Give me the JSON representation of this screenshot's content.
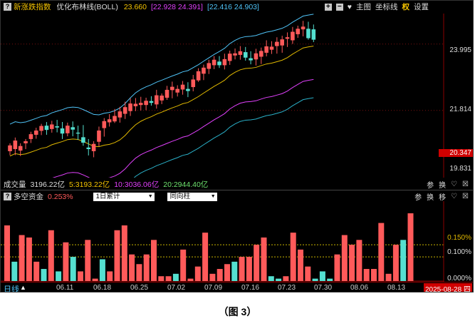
{
  "title_bar": {
    "indicator_name": "新涨跌指数",
    "study_name": "优化布林线(BOLL)",
    "mid_value": "23.660",
    "upper_values": "[22.928 24.391]",
    "lower_values": "[22.416 24.903]",
    "plus_icon": "+",
    "minus_icon": "−",
    "heart_icon": "♥",
    "main_chart_label": "主图",
    "coord_label": "坐标线",
    "weight_label": "权",
    "settings_label": "设置"
  },
  "main_axis": {
    "labels": [
      "23.995",
      "21.814",
      "20.347",
      "19.831"
    ],
    "current_price": "20.347"
  },
  "volume_bar": {
    "label": "成交量",
    "value": "3196.22亿",
    "ma5": "5:3193.22亿",
    "ma10": "10:3036.06亿",
    "ma20": "20:2944.40亿",
    "btn_params": "参",
    "btn_switch": "换",
    "heart_icon": "♡",
    "close_icon": "☒"
  },
  "fund_bar": {
    "label": "多空资金",
    "value": "0.253%",
    "select_period": "1日累计",
    "select_style": "同向柱",
    "btn_params": "参",
    "btn_switch": "换",
    "btn_move": "移",
    "heart_icon": "♡",
    "close_icon": "☒"
  },
  "sub_axis": {
    "labels": [
      "0.150%",
      "0.100%",
      "0.000%"
    ]
  },
  "bottom_axis": {
    "period": "日线",
    "dates": [
      "06.11",
      "06.18",
      "06.25",
      "07.02",
      "07.09",
      "07.16",
      "07.23",
      "07.30",
      "08.06",
      "08.13"
    ],
    "current_date": "2025-08-28",
    "weekday": "四"
  },
  "caption": "（图 3）",
  "colors": {
    "up": "#ff5a5a",
    "down": "#54e0d0",
    "boll_outer": "#4fc3f7",
    "boll_mid": "#e0b800",
    "boll_lower": "#e040fb",
    "boll_lowest": "#2ab0c8"
  },
  "chart_data": [
    {
      "type": "candlestick",
      "title": "优化布林线(BOLL)",
      "ylim": [
        19.6,
        25.0
      ],
      "indicator_values": {
        "mid": 23.66,
        "band1": [
          22.928,
          24.391
        ],
        "band2": [
          22.416,
          24.903
        ]
      },
      "candles": [
        {
          "o": 20.47,
          "h": 20.73,
          "l": 20.34,
          "c": 20.66
        },
        {
          "o": 20.54,
          "h": 20.92,
          "l": 20.34,
          "c": 20.82
        },
        {
          "o": 20.49,
          "h": 20.73,
          "l": 20.31,
          "c": 20.64
        },
        {
          "o": 20.73,
          "h": 20.87,
          "l": 20.54,
          "c": 20.8
        },
        {
          "o": 20.87,
          "h": 21.11,
          "l": 20.74,
          "c": 21.03
        },
        {
          "o": 21.01,
          "h": 21.24,
          "l": 20.88,
          "c": 21.15
        },
        {
          "o": 21.14,
          "h": 21.37,
          "l": 21.0,
          "c": 21.3
        },
        {
          "o": 21.31,
          "h": 21.43,
          "l": 21.01,
          "c": 21.17
        },
        {
          "o": 21.2,
          "h": 21.47,
          "l": 21.08,
          "c": 21.35
        },
        {
          "o": 21.29,
          "h": 21.5,
          "l": 21.09,
          "c": 21.25
        },
        {
          "o": 21.22,
          "h": 21.43,
          "l": 20.87,
          "c": 21.05
        },
        {
          "o": 21.06,
          "h": 21.41,
          "l": 20.96,
          "c": 21.31
        },
        {
          "o": 21.26,
          "h": 21.45,
          "l": 20.96,
          "c": 21.18
        },
        {
          "o": 21.08,
          "h": 21.31,
          "l": 20.84,
          "c": 21.05
        },
        {
          "o": 20.93,
          "h": 21.33,
          "l": 20.65,
          "c": 20.75
        },
        {
          "o": 20.59,
          "h": 20.87,
          "l": 20.33,
          "c": 20.54
        },
        {
          "o": 20.47,
          "h": 20.8,
          "l": 20.27,
          "c": 20.71
        },
        {
          "o": 20.78,
          "h": 21.28,
          "l": 20.63,
          "c": 21.15
        },
        {
          "o": 21.23,
          "h": 21.56,
          "l": 20.95,
          "c": 21.46
        },
        {
          "o": 21.42,
          "h": 21.69,
          "l": 21.28,
          "c": 21.52
        },
        {
          "o": 21.45,
          "h": 21.86,
          "l": 21.4,
          "c": 21.63
        },
        {
          "o": 21.58,
          "h": 21.93,
          "l": 21.41,
          "c": 21.78
        },
        {
          "o": 21.7,
          "h": 22.1,
          "l": 21.53,
          "c": 21.92
        },
        {
          "o": 21.79,
          "h": 22.21,
          "l": 21.63,
          "c": 22.04
        },
        {
          "o": 21.95,
          "h": 22.22,
          "l": 21.79,
          "c": 22.03
        },
        {
          "o": 21.99,
          "h": 22.26,
          "l": 21.81,
          "c": 22.06
        },
        {
          "o": 21.99,
          "h": 22.23,
          "l": 21.82,
          "c": 22.13
        },
        {
          "o": 22.12,
          "h": 22.28,
          "l": 21.97,
          "c": 22.06
        },
        {
          "o": 22.01,
          "h": 22.49,
          "l": 21.87,
          "c": 22.31
        },
        {
          "o": 22.14,
          "h": 22.37,
          "l": 22.02,
          "c": 22.3
        },
        {
          "o": 22.23,
          "h": 22.62,
          "l": 22.16,
          "c": 22.49
        },
        {
          "o": 22.48,
          "h": 22.76,
          "l": 22.21,
          "c": 22.59
        },
        {
          "o": 22.4,
          "h": 22.64,
          "l": 22.27,
          "c": 22.52
        },
        {
          "o": 22.5,
          "h": 22.78,
          "l": 22.33,
          "c": 22.66
        },
        {
          "o": 22.52,
          "h": 22.74,
          "l": 22.25,
          "c": 22.45
        },
        {
          "o": 22.58,
          "h": 22.98,
          "l": 22.44,
          "c": 22.83
        },
        {
          "o": 22.8,
          "h": 23.2,
          "l": 22.75,
          "c": 23.1
        },
        {
          "o": 23.02,
          "h": 23.32,
          "l": 22.81,
          "c": 23.22
        },
        {
          "o": 23.18,
          "h": 23.48,
          "l": 23.01,
          "c": 23.37
        },
        {
          "o": 23.3,
          "h": 23.6,
          "l": 23.17,
          "c": 23.48
        },
        {
          "o": 23.42,
          "h": 23.6,
          "l": 23.21,
          "c": 23.3
        },
        {
          "o": 23.3,
          "h": 23.68,
          "l": 23.16,
          "c": 23.5
        },
        {
          "o": 23.44,
          "h": 23.78,
          "l": 23.31,
          "c": 23.68
        },
        {
          "o": 23.62,
          "h": 23.85,
          "l": 23.49,
          "c": 23.69
        },
        {
          "o": 23.64,
          "h": 23.93,
          "l": 23.48,
          "c": 23.76
        },
        {
          "o": 23.73,
          "h": 23.9,
          "l": 23.45,
          "c": 23.55
        },
        {
          "o": 23.53,
          "h": 23.76,
          "l": 23.33,
          "c": 23.46
        },
        {
          "o": 23.49,
          "h": 23.84,
          "l": 23.29,
          "c": 23.69
        },
        {
          "o": 23.58,
          "h": 23.88,
          "l": 23.34,
          "c": 23.77
        },
        {
          "o": 23.71,
          "h": 24.12,
          "l": 23.59,
          "c": 23.92
        },
        {
          "o": 23.81,
          "h": 24.09,
          "l": 23.67,
          "c": 23.91
        },
        {
          "o": 23.93,
          "h": 24.22,
          "l": 23.68,
          "c": 24.07
        },
        {
          "o": 23.95,
          "h": 24.27,
          "l": 23.71,
          "c": 24.15
        },
        {
          "o": 24.17,
          "h": 24.38,
          "l": 23.9,
          "c": 24.22
        },
        {
          "o": 24.12,
          "h": 24.56,
          "l": 24.0,
          "c": 24.4
        },
        {
          "o": 24.32,
          "h": 24.6,
          "l": 24.2,
          "c": 24.5
        },
        {
          "o": 24.48,
          "h": 24.76,
          "l": 24.25,
          "c": 24.57
        },
        {
          "o": 24.5,
          "h": 24.73,
          "l": 24.14,
          "c": 24.19
        },
        {
          "o": 24.48,
          "h": 24.64,
          "l": 24.06,
          "c": 24.14
        }
      ]
    },
    {
      "type": "bar",
      "title": "多空资金",
      "ylim": [
        0,
        0.253
      ],
      "values": [
        0.23,
        0.08,
        0.19,
        0.18,
        0.08,
        0.05,
        0.21,
        0.04,
        0.16,
        0.1,
        0.04,
        0.17,
        0.01,
        0.09,
        0.04,
        0.21,
        0.23,
        0.11,
        0.07,
        0.11,
        0.17,
        0.02,
        0.02,
        0.03,
        0.13,
        0.01,
        0.06,
        0.2,
        0.03,
        0.05,
        0.07,
        0.08,
        0.1,
        0.1,
        0.15,
        0.18,
        0.02,
        0.01,
        0.02,
        0.2,
        0.13,
        0.06,
        0.01,
        0.04,
        0.01,
        0.11,
        0.19,
        0.15,
        0.17,
        0.05,
        0.05,
        0.24,
        0.03,
        0.15,
        0.17,
        0.28
      ],
      "down_flags": [
        0,
        1,
        0,
        0,
        0,
        1,
        0,
        1,
        0,
        1,
        0,
        0,
        0,
        1,
        0,
        0,
        0,
        0,
        0,
        0,
        0,
        0,
        0,
        1,
        0,
        0,
        0,
        0,
        0,
        0,
        0,
        1,
        0,
        0,
        0,
        0,
        1,
        1,
        0,
        0,
        0,
        0,
        1,
        1,
        1,
        0,
        0,
        0,
        0,
        0,
        0,
        0,
        0,
        0,
        1,
        0
      ]
    }
  ]
}
